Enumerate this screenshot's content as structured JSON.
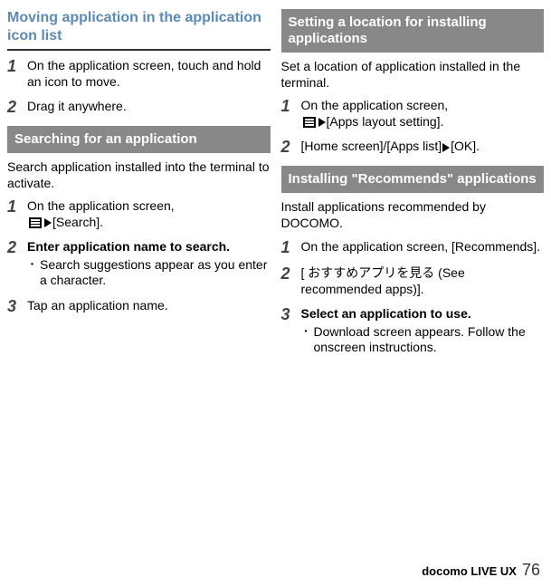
{
  "left": {
    "title": "Moving application in the application icon list",
    "steps1": [
      {
        "num": "1",
        "text": "On the application screen, touch and hold an icon to move."
      },
      {
        "num": "2",
        "text": "Drag it anywhere."
      }
    ],
    "bar1": "Searching for an application",
    "intro1": "Search application installed into the terminal to activate.",
    "steps2": [
      {
        "num": "1",
        "pre": "On the application screen, ",
        "post": "[Search]."
      },
      {
        "num": "2",
        "text": "Enter application name to search.",
        "bullet": "Search suggestions appear as you enter a character."
      },
      {
        "num": "3",
        "text": "Tap an application name."
      }
    ]
  },
  "right": {
    "bar1": "Setting a location for installing applications",
    "intro1": "Set a location of application installed in the terminal.",
    "steps1": [
      {
        "num": "1",
        "pre": "On the application screen, ",
        "post": "[Apps layout setting]."
      },
      {
        "num": "2",
        "pre": "[Home screen]/[Apps list]",
        "post": "[OK]."
      }
    ],
    "bar2": "Installing \"Recommends\" applications",
    "intro2": "Install applications recommended by DOCOMO.",
    "steps2": [
      {
        "num": "1",
        "text": "On the application screen, [Recommends]."
      },
      {
        "num": "2",
        "text": "[ おすすめアプリを見る (See recommended apps)]."
      },
      {
        "num": "3",
        "text": "Select an application to use.",
        "bullet": "Download screen appears. Follow the onscreen instructions."
      }
    ]
  },
  "footer": {
    "label": "docomo LIVE UX",
    "page": "76"
  }
}
